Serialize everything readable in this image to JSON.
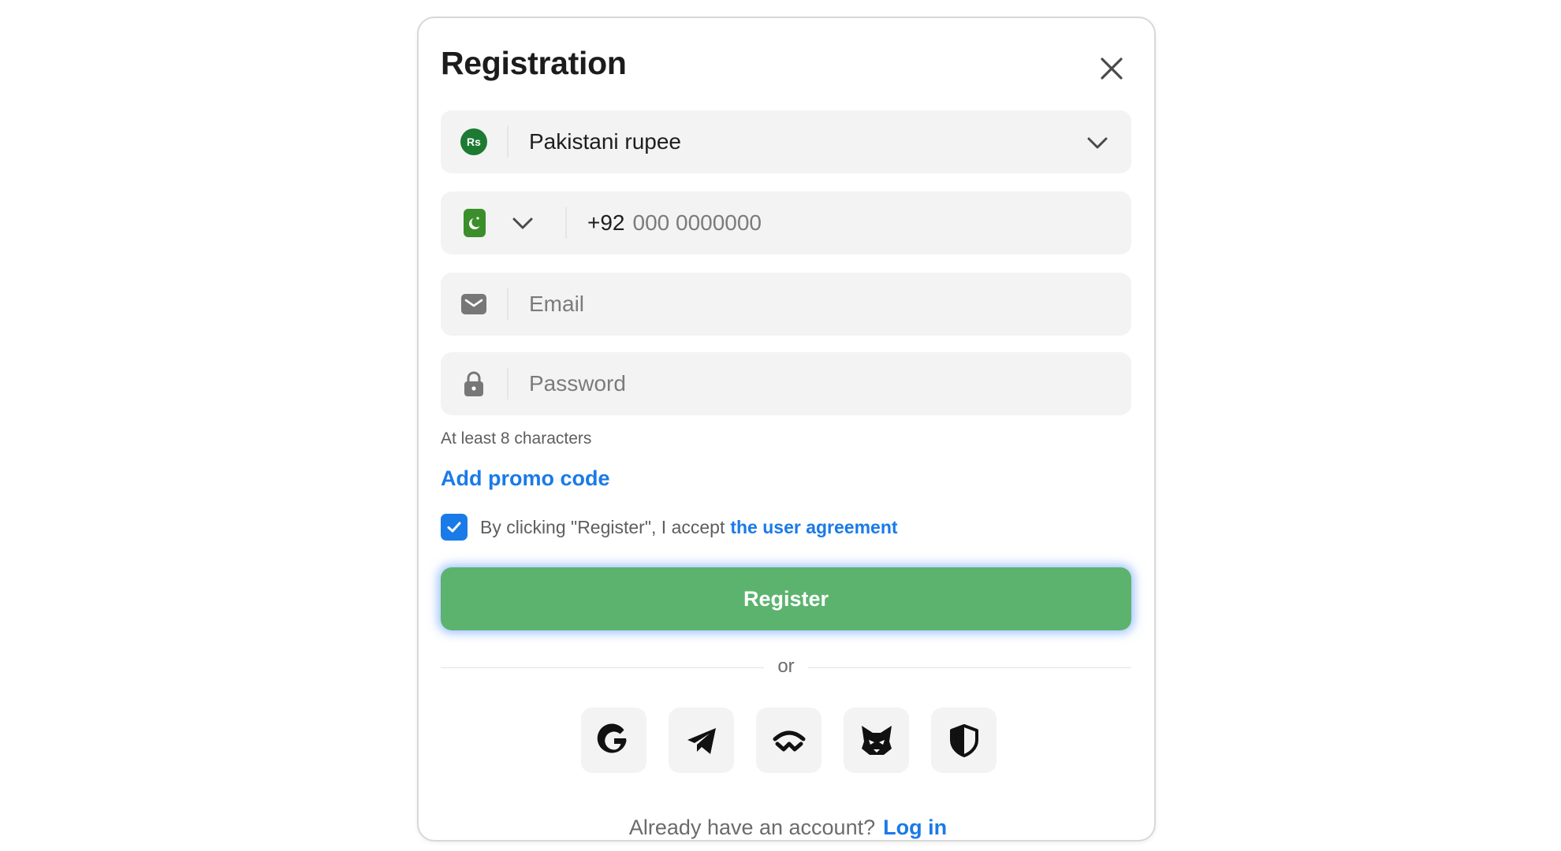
{
  "modal": {
    "title": "Registration"
  },
  "currency": {
    "badge": "Rs",
    "label": "Pakistani rupee"
  },
  "phone": {
    "code": "+92",
    "placeholder": "000 0000000"
  },
  "email": {
    "placeholder": "Email"
  },
  "password": {
    "placeholder": "Password",
    "hint": "At least 8 characters"
  },
  "promo": {
    "label": "Add promo code"
  },
  "agreement": {
    "checked": true,
    "text": "By clicking \"Register\", I accept",
    "link": "the user agreement"
  },
  "register": {
    "label": "Register"
  },
  "divider": {
    "label": "or"
  },
  "socials": [
    "google-icon",
    "telegram-icon",
    "walletconnect-icon",
    "metamask-icon",
    "shield-icon"
  ],
  "footer": {
    "question": "Already have an account?",
    "login": "Log in"
  },
  "colors": {
    "accent": "#1a7ae8",
    "register_button": "#5cb36e",
    "currency_badge": "#1d7a33",
    "pk_flag": "#3a8f2a"
  }
}
